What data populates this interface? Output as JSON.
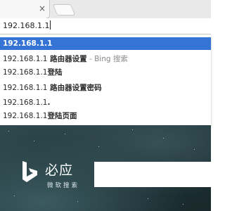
{
  "tabs": {
    "close_glyph": "×"
  },
  "omnibox": {
    "value": "192.168.1.1"
  },
  "suggestions": [
    {
      "typed": "192.168.1.1",
      "rest": "",
      "engine": "",
      "selected": true
    },
    {
      "typed": "192.168.1.1",
      "rest": " 路由器设置",
      "engine": " - Bing 搜索",
      "selected": false
    },
    {
      "typed": "192.168.1.1",
      "rest": "登陆",
      "engine": "",
      "selected": false
    },
    {
      "typed": "192.168.1.1",
      "rest": " 路由器设置密码",
      "engine": "",
      "selected": false
    },
    {
      "typed": "192.168.1.1",
      "rest": ".",
      "engine": "",
      "selected": false
    },
    {
      "typed": "192.168.1.1",
      "rest": "登陆页面",
      "engine": "",
      "selected": false
    }
  ],
  "bing": {
    "title": "必应",
    "subtitle": "微软搜索",
    "search_placeholder": ""
  },
  "colors": {
    "selection": "#3574d4",
    "bing_background": "#223a3e"
  },
  "icons": [
    "close-icon",
    "new-tab-icon",
    "bing-logo-icon",
    "apps-grid-icon"
  ]
}
